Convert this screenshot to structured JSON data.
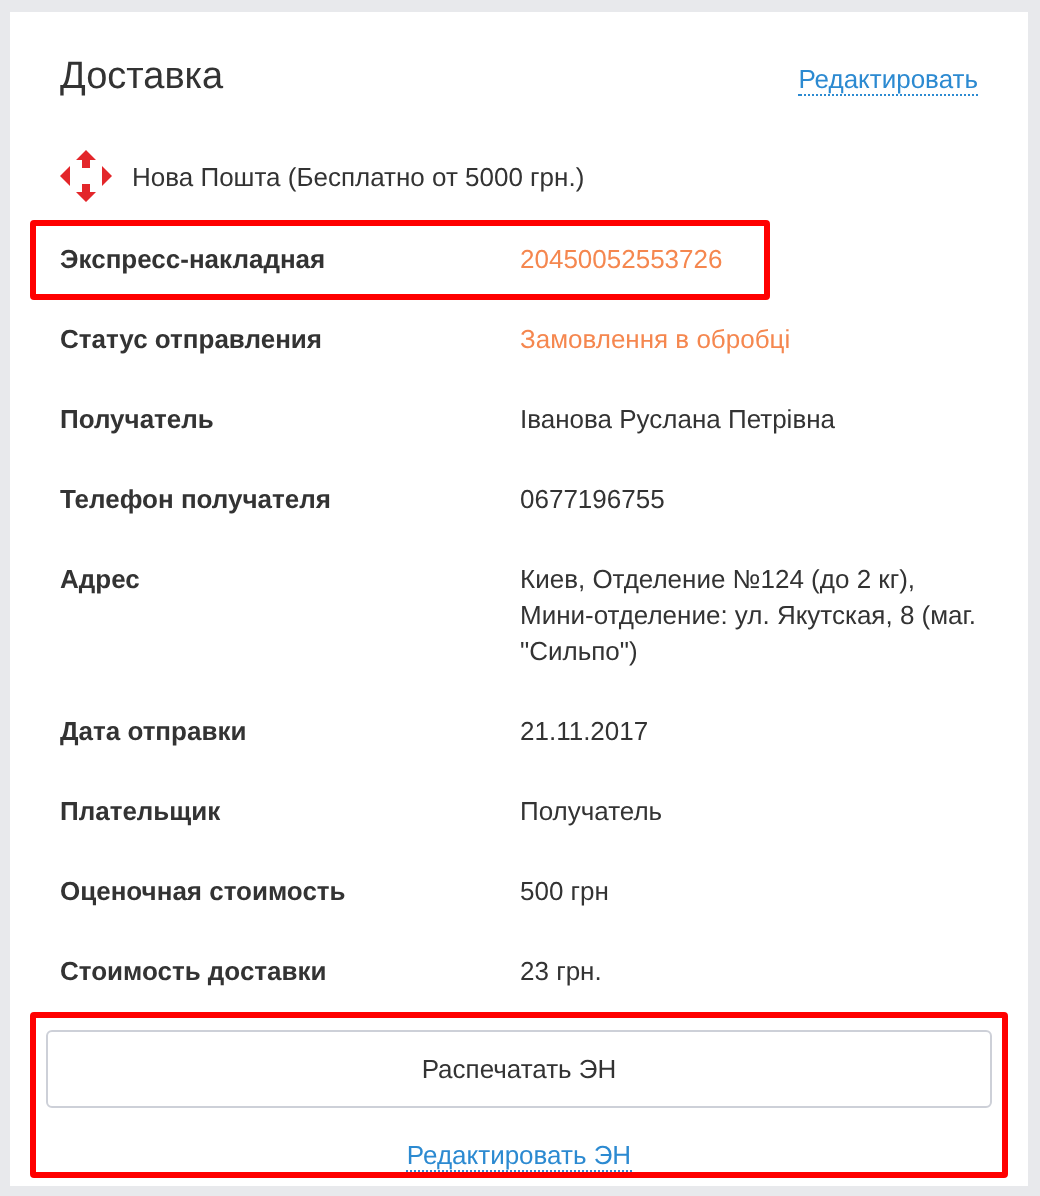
{
  "title": "Доставка",
  "edit_link": "Редактировать",
  "carrier": {
    "name": "Нова Пошта (Бесплатно от 5000 грн.)"
  },
  "fields": [
    {
      "label": "Экспресс-накладная",
      "value": "20450052553726",
      "accent": true,
      "highlighted": true
    },
    {
      "label": "Статус отправления",
      "value": "Замовлення в обробці",
      "accent": true,
      "highlighted": false
    },
    {
      "label": "Получатель",
      "value": "Іванова Руслана Петрівна",
      "accent": false,
      "highlighted": false
    },
    {
      "label": "Телефон получателя",
      "value": "0677196755",
      "accent": false,
      "highlighted": false
    },
    {
      "label": "Адрес",
      "value": "Киев, Отделение №124 (до 2 кг), Мини-отделение: ул. Якутская, 8 (маг. \"Сильпо\")",
      "accent": false,
      "highlighted": false
    },
    {
      "label": "Дата отправки",
      "value": "21.11.2017",
      "accent": false,
      "highlighted": false
    },
    {
      "label": "Плательщик",
      "value": "Получатель",
      "accent": false,
      "highlighted": false
    },
    {
      "label": "Оценочная стоимость",
      "value": "500 грн",
      "accent": false,
      "highlighted": false
    },
    {
      "label": "Стоимость доставки",
      "value": "23 грн.",
      "accent": false,
      "highlighted": false
    }
  ],
  "actions": {
    "highlighted": true,
    "print_button": "Распечатать ЭН",
    "edit_link": "Редактировать ЭН"
  }
}
